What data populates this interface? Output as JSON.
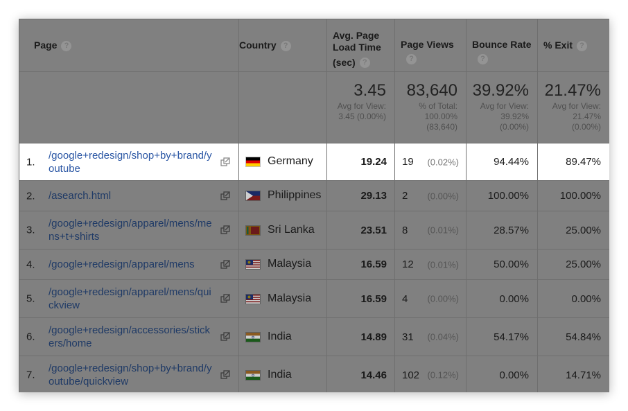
{
  "headers": {
    "page": "Page",
    "country": "Country",
    "load_line1": "Avg. Page",
    "load_line2": "Load Time",
    "load_line3": "(sec)",
    "page_views": "Page Views",
    "bounce_rate": "Bounce Rate",
    "exit": "% Exit",
    "help_glyph": "?"
  },
  "totals": {
    "load_value": "3.45",
    "load_sub1": "Avg for View:",
    "load_sub2": "3.45 (0.00%)",
    "views_value": "83,640",
    "views_sub1": "% of Total:",
    "views_sub2": "100.00%",
    "views_sub3": "(83,640)",
    "bounce_value": "39.92%",
    "bounce_sub1": "Avg for View:",
    "bounce_sub2": "39.92%",
    "bounce_sub3": "(0.00%)",
    "exit_value": "21.47%",
    "exit_sub1": "Avg for View:",
    "exit_sub2": "21.47%",
    "exit_sub3": "(0.00%)"
  },
  "rows": [
    {
      "index": "1.",
      "page": "/google+redesign/shop+by+brand/youtube",
      "country": "Germany",
      "flag": "germany",
      "load": "19.24",
      "views": "19",
      "views_pct": "(0.02%)",
      "bounce": "94.44%",
      "exit": "89.47%",
      "highlighted": true
    },
    {
      "index": "2.",
      "page": "/asearch.html",
      "country": "Philippines",
      "flag": "philippines",
      "load": "29.13",
      "views": "2",
      "views_pct": "(0.00%)",
      "bounce": "100.00%",
      "exit": "100.00%",
      "highlighted": false
    },
    {
      "index": "3.",
      "page": "/google+redesign/apparel/mens/mens+t+shirts",
      "country": "Sri Lanka",
      "flag": "srilanka",
      "load": "23.51",
      "views": "8",
      "views_pct": "(0.01%)",
      "bounce": "28.57%",
      "exit": "25.00%",
      "highlighted": false
    },
    {
      "index": "4.",
      "page": "/google+redesign/apparel/mens",
      "country": "Malaysia",
      "flag": "malaysia",
      "load": "16.59",
      "views": "12",
      "views_pct": "(0.01%)",
      "bounce": "50.00%",
      "exit": "25.00%",
      "highlighted": false
    },
    {
      "index": "5.",
      "page": "/google+redesign/apparel/mens/quickview",
      "country": "Malaysia",
      "flag": "malaysia",
      "load": "16.59",
      "views": "4",
      "views_pct": "(0.00%)",
      "bounce": "0.00%",
      "exit": "0.00%",
      "highlighted": false
    },
    {
      "index": "6.",
      "page": "/google+redesign/accessories/stickers/home",
      "country": "India",
      "flag": "india",
      "load": "14.89",
      "views": "31",
      "views_pct": "(0.04%)",
      "bounce": "54.17%",
      "exit": "54.84%",
      "highlighted": false
    },
    {
      "index": "7.",
      "page": "/google+redesign/shop+by+brand/youtube/quickview",
      "country": "India",
      "flag": "india",
      "load": "14.46",
      "views": "102",
      "views_pct": "(0.12%)",
      "bounce": "0.00%",
      "exit": "14.71%",
      "highlighted": false
    }
  ],
  "icons": {
    "help": "question-circle-icon",
    "external": "external-link-icon"
  },
  "colors": {
    "overlay": "#808080",
    "link": "#2a56a4",
    "highlight_row": "#ffffff"
  }
}
